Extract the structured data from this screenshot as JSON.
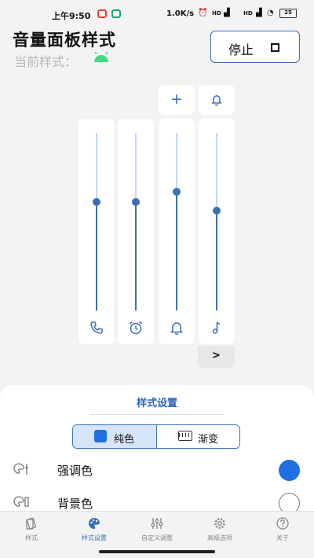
{
  "status_bar": {
    "time": "上午9:50",
    "net_speed": "1.0K/s",
    "sim1": "HD",
    "sim2": "HD",
    "battery": "25"
  },
  "header": {
    "title": "音量面板样式",
    "current_style_label": "当前样式：",
    "stop_label": "停止"
  },
  "panel": {
    "top_buttons": [
      "+",
      "bell"
    ],
    "sliders": [
      {
        "name": "call",
        "icon": "phone-icon",
        "level": 0.61
      },
      {
        "name": "alarm",
        "icon": "alarm-clock-icon",
        "level": 0.61
      },
      {
        "name": "ring",
        "icon": "bell-icon",
        "level": 0.67
      },
      {
        "name": "media",
        "icon": "music-note-icon",
        "level": 0.56
      }
    ],
    "expand_label": ">"
  },
  "style_settings": {
    "title": "样式设置",
    "toggle": {
      "solid": "纯色",
      "gradient": "渐变",
      "selected": "solid"
    },
    "rows": [
      {
        "label": "强调色",
        "color": "#1f6fe0"
      },
      {
        "label": "背景色",
        "color": "#ffffff"
      }
    ]
  },
  "bottom_nav": [
    {
      "label": "样式",
      "icon": "style-icon"
    },
    {
      "label": "样式设置",
      "icon": "palette-icon"
    },
    {
      "label": "自定义调整",
      "icon": "sliders-icon"
    },
    {
      "label": "高级选项",
      "icon": "gear-icon"
    },
    {
      "label": "关于",
      "icon": "help-icon"
    }
  ],
  "colors": {
    "accent": "#3a6fb6",
    "track": "#c5d7f4",
    "accent_swatch": "#1f6fe0"
  }
}
